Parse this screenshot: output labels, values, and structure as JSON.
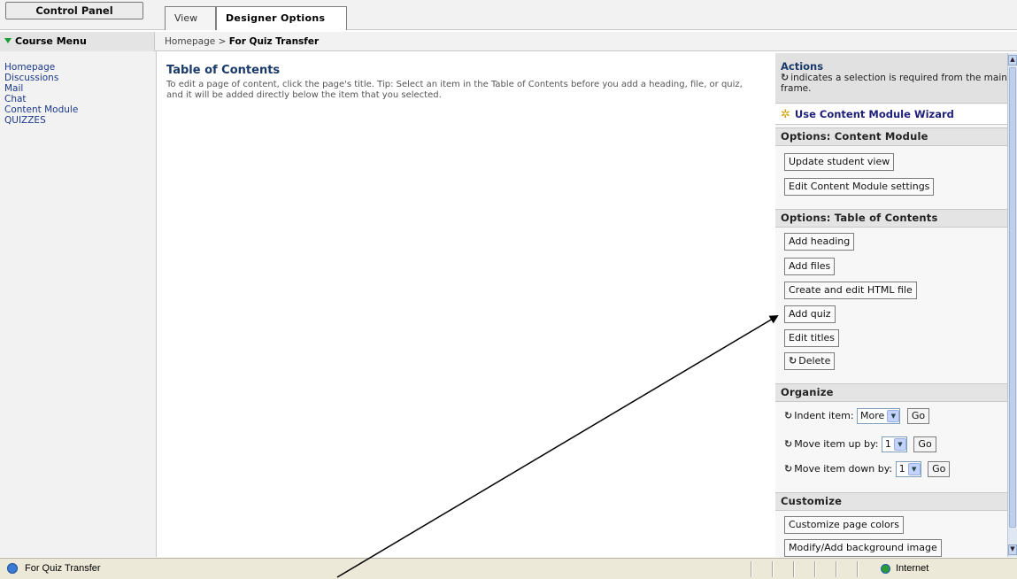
{
  "control_panel": {
    "label": "Control Panel"
  },
  "tabs": [
    {
      "label": "View"
    },
    {
      "label": "Designer Options"
    }
  ],
  "course_menu": {
    "title": "Course Menu",
    "items": [
      "Homepage",
      "Discussions",
      "Mail",
      "Chat",
      "Content Module",
      "QUIZZES"
    ]
  },
  "breadcrumb": {
    "root": "Homepage",
    "separator": ">",
    "current": "For Quiz Transfer"
  },
  "main": {
    "title": "Table of Contents",
    "description": "To edit a page of content, click the page's title. Tip: Select an item in the Table of Contents before you add a heading, file, or quiz, and it will be added directly below the item that you selected."
  },
  "actions": {
    "title": "Actions",
    "note": "indicates a selection is required from the main frame.",
    "wizard": "Use Content Module Wizard"
  },
  "options_content_module": {
    "title": "Options: Content Module",
    "buttons": [
      "Update student view",
      "Edit Content Module settings"
    ]
  },
  "options_toc": {
    "title": "Options: Table of Contents",
    "buttons": [
      "Add heading",
      "Add files",
      "Create and edit HTML file",
      "Add quiz",
      "Edit titles",
      "Delete"
    ]
  },
  "organize": {
    "title": "Organize",
    "indent_label": "Indent item:",
    "indent_value": "More",
    "up_label": "Move item up by:",
    "up_value": "1",
    "down_label": "Move item down by:",
    "down_value": "1",
    "go": "Go"
  },
  "customize": {
    "title": "Customize",
    "buttons": [
      "Customize page colors",
      "Modify/Add background image"
    ]
  },
  "statusbar": {
    "text": "For Quiz Transfer",
    "zone": "Internet"
  },
  "colors": {
    "link": "#1a3a8a",
    "accent_green": "#1a9e33",
    "arrow": "#000000"
  }
}
